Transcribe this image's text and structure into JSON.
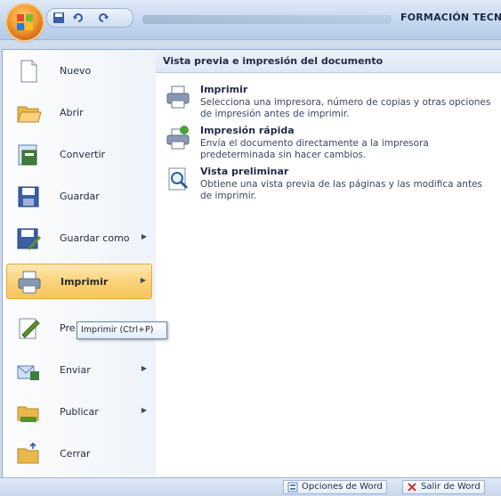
{
  "window": {
    "title": "FORMACIÓN TECN",
    "office_button_icon": "office-logo-icon",
    "quick_access": [
      "office-save-icon",
      "undo-icon",
      "redo-icon"
    ]
  },
  "menu": {
    "items": [
      {
        "label": "Nuevo",
        "icon": "new-document-icon",
        "has_submenu": false,
        "selected": false
      },
      {
        "label": "Abrir",
        "icon": "open-folder-icon",
        "has_submenu": false,
        "selected": false
      },
      {
        "label": "Convertir",
        "icon": "convert-icon",
        "has_submenu": false,
        "selected": false
      },
      {
        "label": "Guardar",
        "icon": "save-icon",
        "has_submenu": false,
        "selected": false
      },
      {
        "label": "Guardar como",
        "icon": "save-as-icon",
        "has_submenu": true,
        "selected": false
      },
      {
        "label": "Imprimir",
        "icon": "printer-icon",
        "has_submenu": true,
        "selected": true
      },
      {
        "label": "Pre",
        "icon": "prepare-icon",
        "has_submenu": false,
        "selected": false
      },
      {
        "label": "Enviar",
        "icon": "send-icon",
        "has_submenu": true,
        "selected": false
      },
      {
        "label": "Publicar",
        "icon": "publish-icon",
        "has_submenu": true,
        "selected": false
      },
      {
        "label": "Cerrar",
        "icon": "close-folder-icon",
        "has_submenu": false,
        "selected": false
      }
    ],
    "submenu_arrow": "▶"
  },
  "right_pane": {
    "header": "Vista previa e impresión del documento",
    "entries": [
      {
        "title": "Imprimir",
        "icon": "printer-icon",
        "description": "Selecciona una impresora, número de copias y otras opciones de impresión antes de imprimir."
      },
      {
        "title": "Impresión rápida",
        "icon": "quick-print-icon",
        "description": "Envía el documento directamente a la impresora predeterminada sin hacer cambios."
      },
      {
        "title": "Vista preliminar",
        "icon": "print-preview-icon",
        "description": "Obtiene una vista previa de las páginas y las modifica antes de imprimir."
      }
    ]
  },
  "tooltip": {
    "text": "Imprimir (Ctrl+P)"
  },
  "bottom_bar": {
    "options_label": "Opciones de Word",
    "exit_label": "Salir de Word"
  },
  "colors": {
    "selected_item": "#f7c55a",
    "office_button": "#f29a2e",
    "header_text": "#1f2a44"
  }
}
